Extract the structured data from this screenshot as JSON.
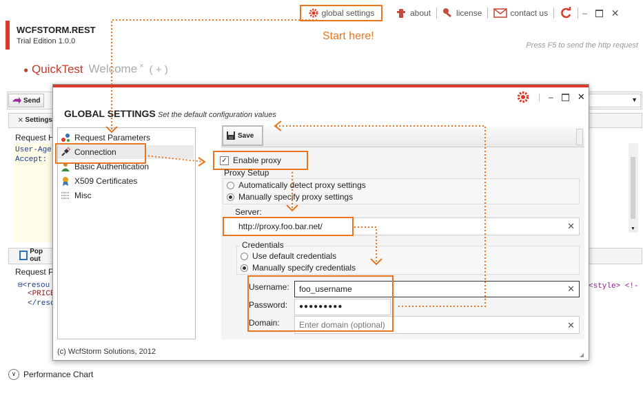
{
  "topmenu": {
    "global_settings": "global settings",
    "about": "about",
    "license": "license",
    "contact_us": "contact us"
  },
  "annotation": {
    "start_here": "Start here!"
  },
  "app": {
    "title": "WCFSTORM.REST",
    "edition": "Trial Edition 1.0.0",
    "hint": "Press F5 to send the http request"
  },
  "tabs": [
    {
      "label": "QuickTest"
    },
    {
      "label": "Welcome"
    },
    {
      "label": "( + )"
    }
  ],
  "background": {
    "send_label": "Send",
    "settings_label": "Settings",
    "request_headers_label": "Request H",
    "header_line1": "User-Age",
    "header_line2": "Accept:",
    "popout_label": "Pop out",
    "request_params_label": "Request P",
    "xml_line1": "<resou",
    "xml_line2": "<PRICE",
    "xml_line3": "</reso",
    "style_snippet": "<style> <!-",
    "performance_label": "Performance Chart"
  },
  "dialog": {
    "title": "GLOBAL SETTINGS",
    "subtitle": "Set the default configuration values",
    "nav": [
      {
        "label": "Request Parameters"
      },
      {
        "label": "Connection"
      },
      {
        "label": "Basic Authentication"
      },
      {
        "label": "X509 Certificates"
      },
      {
        "label": "Misc"
      }
    ],
    "save_label": "Save",
    "enable_proxy_label": "Enable proxy",
    "enable_proxy_checked": true,
    "proxy_setup_label": "Proxy Setup",
    "auto_detect_label": "Automatically detect proxy settings",
    "manual_proxy_label": "Manually specify proxy settings",
    "server_label": "Server:",
    "server_value": "http://proxy.foo.bar.net/",
    "credentials_label": "Credentials",
    "default_creds_label": "Use default credentials",
    "manual_creds_label": "Manually specify credentials",
    "username_label": "Username:",
    "username_value": "foo_username",
    "password_label": "Password:",
    "password_value": "●●●●●●●●●",
    "domain_label": "Domain:",
    "domain_placeholder": "Enter domain (optional)",
    "footer": "(c) WcfStorm Solutions, 2012"
  },
  "colors": {
    "accent": "#e8741e",
    "brand": "#d8392b"
  }
}
